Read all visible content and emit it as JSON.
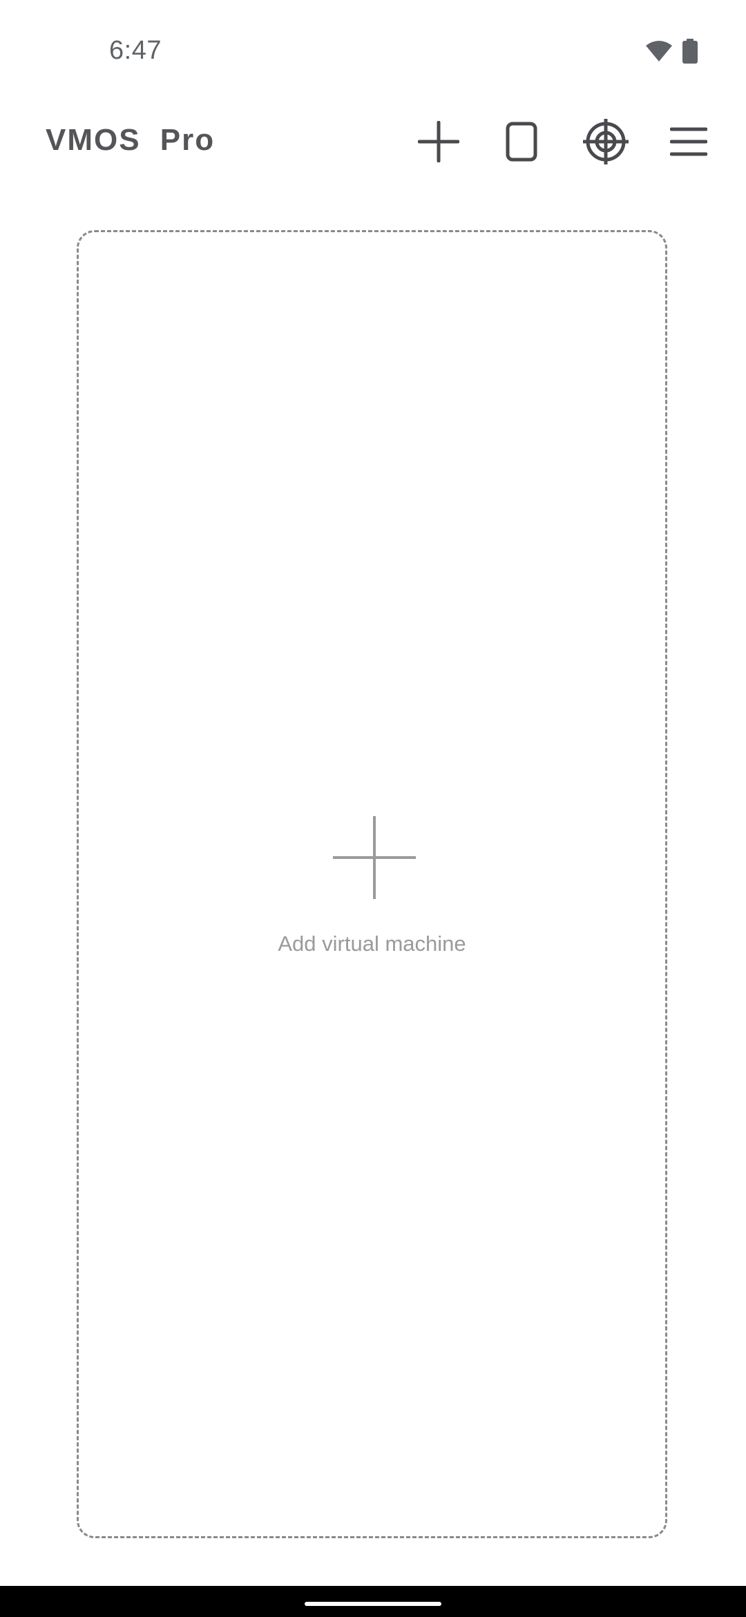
{
  "status_bar": {
    "time": "6:47",
    "icons": [
      "wifi-icon",
      "battery-icon"
    ]
  },
  "app_bar": {
    "title": "VMOS Pro",
    "actions": [
      "add-icon",
      "phone-icon",
      "target-icon",
      "menu-icon"
    ]
  },
  "main": {
    "add_card": {
      "icon": "plus-icon",
      "label": "Add virtual machine"
    }
  },
  "colors": {
    "title": "#555559",
    "icon": "#4a4a4e",
    "card_border": "#8a8a8a",
    "label": "#9a9a9a",
    "nav_bar": "#000000"
  }
}
